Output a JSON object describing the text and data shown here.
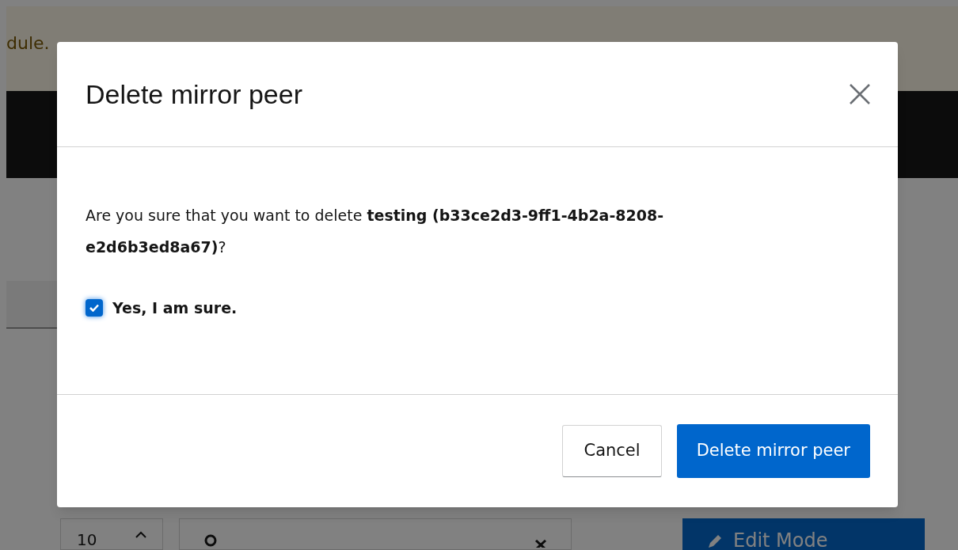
{
  "background": {
    "alert_text": "dule.",
    "per_page": "10",
    "edit_button": "Edit Mode"
  },
  "dialog": {
    "title": "Delete mirror peer",
    "message": "Are you sure that you want to delete **testing (b33ce2d3-9ff1-4b2a-8208-e2d6b3ed8a67)**?",
    "confirm": {
      "label": "Yes, I am sure.",
      "checked": true
    },
    "buttons": [
      {
        "label": "Cancel",
        "kind": "secondary"
      },
      {
        "label": "Delete mirror peer",
        "kind": "primary"
      }
    ]
  }
}
